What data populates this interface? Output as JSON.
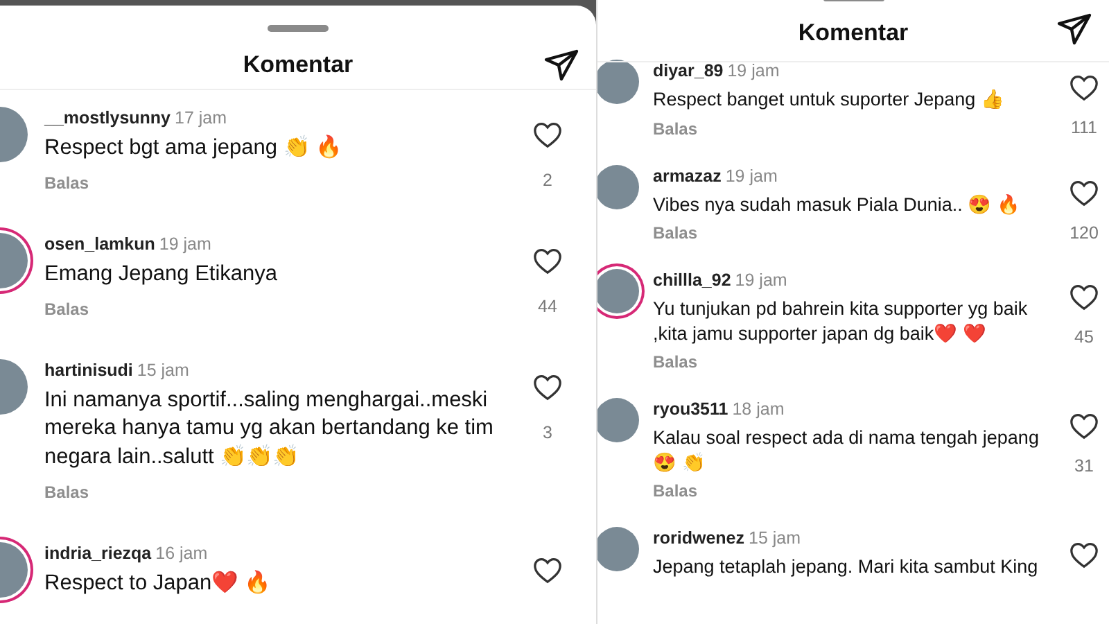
{
  "panels": [
    {
      "title": "Komentar",
      "comments": [
        {
          "username": "__mostlysunny",
          "time": "17 jam",
          "text": "Respect bgt ama jepang 👏 🔥",
          "reply": "Balas",
          "likes": "2",
          "story_ring": false
        },
        {
          "username": "osen_lamkun",
          "time": "19 jam",
          "text": "Emang Jepang Etikanya",
          "reply": "Balas",
          "likes": "44",
          "story_ring": true
        },
        {
          "username": "hartinisudi",
          "time": "15 jam",
          "text": "Ini namanya sportif...saling menghargai..meski mereka hanya tamu yg akan bertandang ke tim negara lain..salutt 👏👏👏",
          "reply": "Balas",
          "likes": "3",
          "story_ring": false
        },
        {
          "username": "indria_riezqa",
          "time": "16 jam",
          "text": "Respect to Japan❤️ 🔥",
          "story_ring": true
        }
      ]
    },
    {
      "title": "Komentar",
      "comments": [
        {
          "username": "diyar_89",
          "time": "19 jam",
          "text": "Respect banget untuk suporter Jepang 👍",
          "reply": "Balas",
          "likes": "111",
          "story_ring": false
        },
        {
          "username": "armazaz",
          "time": "19 jam",
          "text": "Vibes nya sudah masuk Piala Dunia.. 😍 🔥",
          "reply": "Balas",
          "likes": "120",
          "story_ring": false
        },
        {
          "username": "chillla_92",
          "time": "19 jam",
          "text": "Yu tunjukan pd bahrein kita supporter yg baik ,kita jamu supporter japan dg baik❤️ ❤️",
          "reply": "Balas",
          "likes": "45",
          "story_ring": true
        },
        {
          "username": "ryou3511",
          "time": "18 jam",
          "text": "Kalau soal respect ada di nama tengah jepang 😍 👏",
          "reply": "Balas",
          "likes": "31",
          "story_ring": false
        },
        {
          "username": "roridwenez",
          "time": "15 jam",
          "text": "Jepang tetaplah jepang. Mari kita sambut King",
          "story_ring": false
        }
      ]
    }
  ]
}
